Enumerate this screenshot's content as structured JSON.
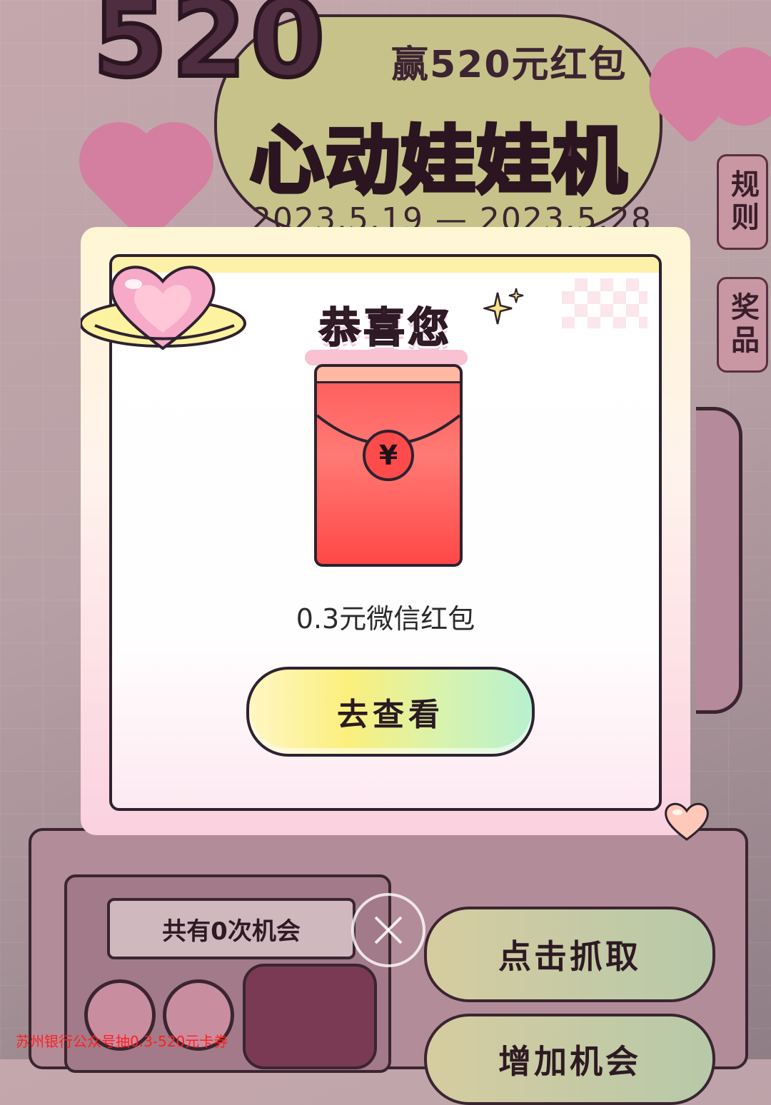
{
  "event": {
    "number": "520",
    "subtitle": "赢520元红包",
    "title": "心动娃娃机",
    "date_range": "2023.5.19 — 2023.5.28"
  },
  "side_tabs": {
    "rules": "规则",
    "prizes": "奖品"
  },
  "machine": {
    "chances": "共有0次机会",
    "grab_button": "点击抓取",
    "more_chances_button": "增加机会"
  },
  "modal": {
    "heading": "恭喜您",
    "prize_text": "0.3元微信红包",
    "currency_symbol": "¥",
    "view_button": "去查看",
    "close_icon": "close-icon"
  },
  "watermark": "苏州银行公众号抽0.3-520元卡券",
  "colors": {
    "envelope_red": "#ff5a5a",
    "button_yellow": "#fbef7d",
    "button_mint": "#b8f0cf",
    "accent_pink": "#f8c2d3"
  }
}
